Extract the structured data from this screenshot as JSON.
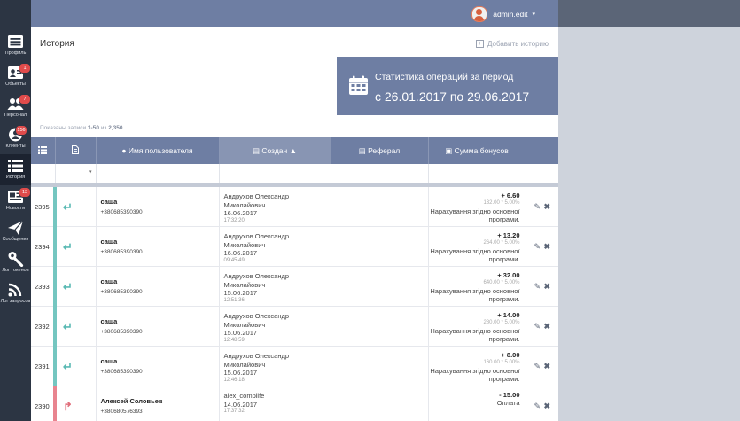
{
  "sidebar": {
    "items": [
      {
        "label": "Профиль",
        "icon": "profile-card-icon",
        "badge": ""
      },
      {
        "label": "Объекты",
        "icon": "objects-icon",
        "badge": "1"
      },
      {
        "label": "Персонал",
        "icon": "staff-icon",
        "badge": "7"
      },
      {
        "label": "Клиенты",
        "icon": "clients-icon",
        "badge": "156"
      },
      {
        "label": "История",
        "icon": "history-list-icon",
        "badge": "",
        "active": true
      },
      {
        "label": "Новости",
        "icon": "news-icon",
        "badge": "13"
      },
      {
        "label": "Сообщения",
        "icon": "paper-plane-icon",
        "badge": ""
      },
      {
        "label": "Лог токенов",
        "icon": "wrench-icon",
        "badge": ""
      },
      {
        "label": "Лог запросов",
        "icon": "rss-icon",
        "badge": ""
      }
    ]
  },
  "header": {
    "username": "admin.edit",
    "caret": "▾"
  },
  "page": {
    "title": "История",
    "add_label": "Добавить историю"
  },
  "stats": {
    "title": "Статистика операций за период",
    "range": "с 26.01.2017 по 29.06.2017"
  },
  "records": {
    "prefix": "Показаны записи",
    "range": "1-50",
    "mid": "из",
    "total": "2,350",
    "end": "."
  },
  "table": {
    "headers": {
      "user": "Имя пользователя",
      "created": "Создан",
      "referral": "Реферал",
      "bonus": "Сумма бонусов"
    },
    "rows": [
      {
        "id": "2395",
        "direction": "in",
        "user": "саша",
        "phone": "+380685390390",
        "creator": "Андрухов Олександр Миколайович",
        "date": "16.06.2017",
        "time": "17:32:20",
        "amount": "+ 6.60",
        "calc": "132.00 * 5.00%",
        "desc": "Нарахування згідно основної програми."
      },
      {
        "id": "2394",
        "direction": "in",
        "user": "саша",
        "phone": "+380685390390",
        "creator": "Андрухов Олександр Миколайович",
        "date": "16.06.2017",
        "time": "09:45:49",
        "amount": "+ 13.20",
        "calc": "264.00 * 5.00%",
        "desc": "Нарахування згідно основної програми."
      },
      {
        "id": "2393",
        "direction": "in",
        "user": "саша",
        "phone": "+380685390390",
        "creator": "Андрухов Олександр Миколайович",
        "date": "15.06.2017",
        "time": "12:51:36",
        "amount": "+ 32.00",
        "calc": "640.00 * 5.00%",
        "desc": "Нарахування згідно основної програми."
      },
      {
        "id": "2392",
        "direction": "in",
        "user": "саша",
        "phone": "+380685390390",
        "creator": "Андрухов Олександр Миколайович",
        "date": "15.06.2017",
        "time": "12:48:59",
        "amount": "+ 14.00",
        "calc": "280.00 * 5.00%",
        "desc": "Нарахування згідно основної програми."
      },
      {
        "id": "2391",
        "direction": "in",
        "user": "саша",
        "phone": "+380685390390",
        "creator": "Андрухов Олександр Миколайович",
        "date": "15.06.2017",
        "time": "12:46:18",
        "amount": "+ 8.00",
        "calc": "160.00 * 5.00%",
        "desc": "Нарахування згідно основної програми."
      },
      {
        "id": "2390",
        "direction": "out",
        "user": "Алексей Соловьев",
        "phone": "+380680576393",
        "creator": "alex_complife",
        "date": "14.06.2017",
        "time": "17:37:32",
        "amount": "- 15.00",
        "calc": "",
        "desc": "Оплата"
      }
    ]
  },
  "colors": {
    "accent": "#6e7ea3",
    "sidebar": "#2c3543",
    "in_arrow": "#5bbab4",
    "out_arrow": "#e06c79",
    "badge": "#e04b4b"
  }
}
